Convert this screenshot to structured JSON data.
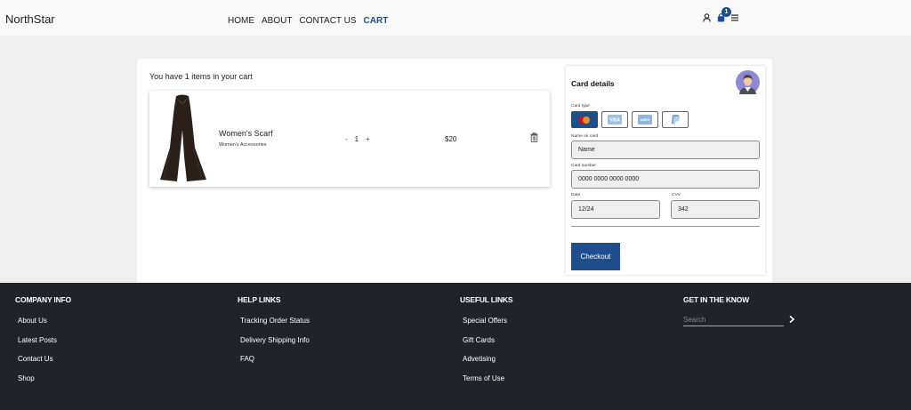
{
  "header": {
    "brand": "NorthStar",
    "nav": [
      {
        "label": "HOME",
        "active": false
      },
      {
        "label": "ABOUT",
        "active": false
      },
      {
        "label": "CONTACT US",
        "active": false
      },
      {
        "label": "CART",
        "active": true
      }
    ],
    "icons": [
      "user-icon",
      "shopping-bag-icon",
      "menu-icon"
    ],
    "cart_count": "1"
  },
  "cart": {
    "summary": "You have 1 items in your cart",
    "item": {
      "name": "Women's Scarf",
      "category": "Women's Accessories",
      "qty_minus": "-",
      "quantity": "1",
      "qty_plus": "+",
      "price": "$20"
    }
  },
  "card": {
    "title": "Card details",
    "card_type_label": "Card type",
    "card_types": [
      "mastercard",
      "visa",
      "amex",
      "paypal"
    ],
    "name_label": "Name on card",
    "name_value": "Name",
    "number_label": "Card number",
    "number_value": "0000 0000 0000 0000",
    "date_label": "Date",
    "date_value": "12/24",
    "cvv_label": "CVV",
    "cvv_value": "342",
    "checkout_label": "Checkout"
  },
  "footer": {
    "company": {
      "title": "COMPANY INFO",
      "links": [
        "About Us",
        "Latest Posts",
        "Contact Us",
        "Shop"
      ]
    },
    "help": {
      "title": "HELP LINKS",
      "links": [
        "Tracking Order Status",
        "Delivery Shipping Info",
        "FAQ"
      ]
    },
    "useful": {
      "title": "USEFUL LINKS",
      "links": [
        "Special Offers",
        "Gift Cards",
        "Advetising",
        "Terms of Use"
      ]
    },
    "know": {
      "title": "GET IN THE KNOW",
      "search_placeholder": "Search"
    }
  },
  "colors": {
    "accent": "#1f4e8c",
    "footer_bg": "#20232a",
    "page_bg": "#efefef"
  }
}
